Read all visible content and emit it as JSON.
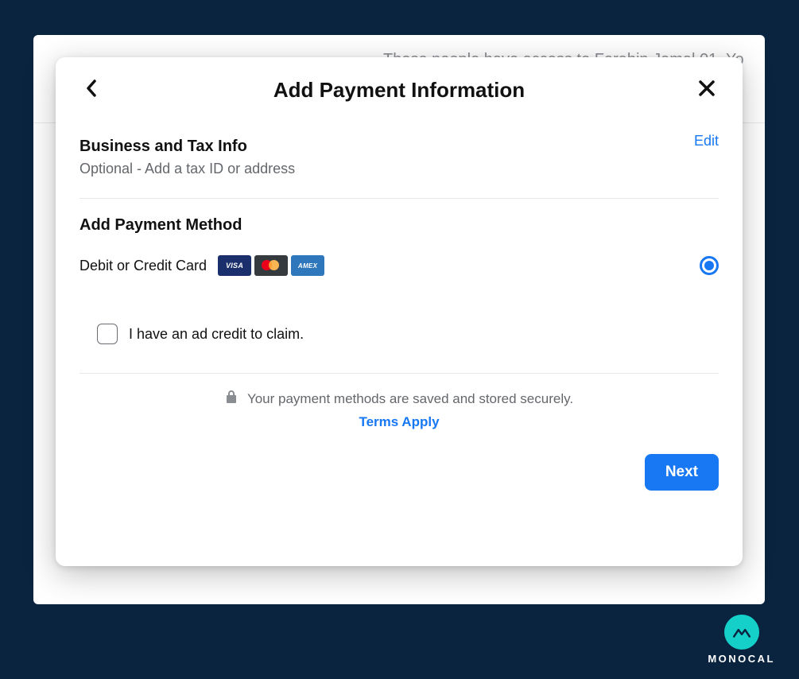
{
  "backdrop": {
    "text": "These people have access to Farahin Jamal 01. Yo"
  },
  "modal": {
    "title": "Add Payment Information",
    "business_section": {
      "title": "Business and Tax Info",
      "subtitle": "Optional - Add a tax ID or address",
      "edit_label": "Edit"
    },
    "payment_section": {
      "title": "Add Payment Method",
      "option_label": "Debit or Credit Card",
      "cards": {
        "visa": "VISA",
        "amex": "AMEX"
      }
    },
    "credit": {
      "label": "I have an ad credit to claim."
    },
    "secure": {
      "text": "Your payment methods are saved and stored securely.",
      "terms": "Terms Apply"
    },
    "next_label": "Next"
  },
  "watermark": {
    "text": "MONOCAL"
  }
}
